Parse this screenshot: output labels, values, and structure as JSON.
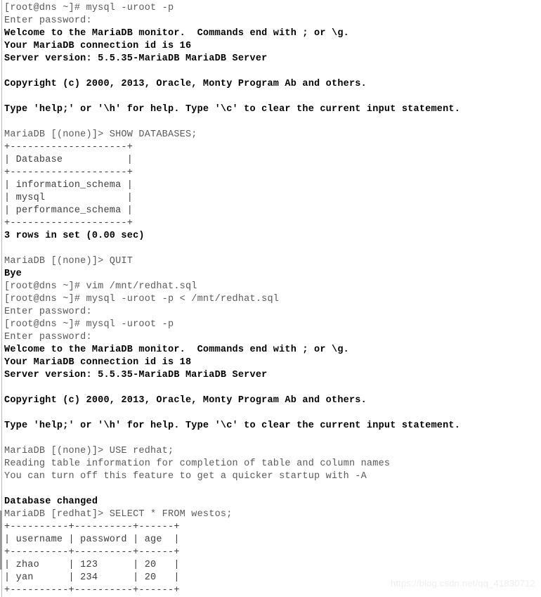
{
  "terminal": {
    "title": "MariaDB terminal session",
    "background_color": "#ffffff",
    "prompt_color": "#5a5a5a",
    "output_color": "#000000",
    "table_color": "#3d3d3d",
    "lines": [
      {
        "id": "l01",
        "style": "prompt",
        "text": "[root@dns ~]# mysql -uroot -p"
      },
      {
        "id": "l02",
        "style": "prompt",
        "text": "Enter password:"
      },
      {
        "id": "l03",
        "style": "bold",
        "text": "Welcome to the MariaDB monitor.  Commands end with ; or \\g."
      },
      {
        "id": "l04",
        "style": "bold",
        "text": "Your MariaDB connection id is 16"
      },
      {
        "id": "l05",
        "style": "bold",
        "text": "Server version: 5.5.35-MariaDB MariaDB Server"
      },
      {
        "id": "l06",
        "style": "blank",
        "text": " "
      },
      {
        "id": "l07",
        "style": "bold",
        "text": "Copyright (c) 2000, 2013, Oracle, Monty Program Ab and others."
      },
      {
        "id": "l08",
        "style": "blank",
        "text": " "
      },
      {
        "id": "l09",
        "style": "bold",
        "text": "Type 'help;' or '\\h' for help. Type '\\c' to clear the current input statement."
      },
      {
        "id": "l10",
        "style": "blank",
        "text": " "
      },
      {
        "id": "l11",
        "style": "prompt",
        "text": "MariaDB [(none)]> SHOW DATABASES;"
      },
      {
        "id": "l12",
        "style": "art",
        "text": "+--------------------+"
      },
      {
        "id": "l13",
        "style": "art",
        "text": "| Database           |"
      },
      {
        "id": "l14",
        "style": "art",
        "text": "+--------------------+"
      },
      {
        "id": "l15",
        "style": "art",
        "text": "| information_schema |"
      },
      {
        "id": "l16",
        "style": "art",
        "text": "| mysql              |"
      },
      {
        "id": "l17",
        "style": "art",
        "text": "| performance_schema |"
      },
      {
        "id": "l18",
        "style": "art",
        "text": "+--------------------+"
      },
      {
        "id": "l19",
        "style": "bold",
        "text": "3 rows in set (0.00 sec)"
      },
      {
        "id": "l20",
        "style": "blank",
        "text": " "
      },
      {
        "id": "l21",
        "style": "prompt",
        "text": "MariaDB [(none)]> QUIT"
      },
      {
        "id": "l22",
        "style": "bold",
        "text": "Bye"
      },
      {
        "id": "l23",
        "style": "prompt",
        "text": "[root@dns ~]# vim /mnt/redhat.sql"
      },
      {
        "id": "l24",
        "style": "prompt",
        "text": "[root@dns ~]# mysql -uroot -p < /mnt/redhat.sql"
      },
      {
        "id": "l25",
        "style": "prompt",
        "text": "Enter password:"
      },
      {
        "id": "l26",
        "style": "prompt",
        "text": "[root@dns ~]# mysql -uroot -p"
      },
      {
        "id": "l27",
        "style": "prompt",
        "text": "Enter password:"
      },
      {
        "id": "l28",
        "style": "bold",
        "text": "Welcome to the MariaDB monitor.  Commands end with ; or \\g."
      },
      {
        "id": "l29",
        "style": "bold",
        "text": "Your MariaDB connection id is 18"
      },
      {
        "id": "l30",
        "style": "bold",
        "text": "Server version: 5.5.35-MariaDB MariaDB Server"
      },
      {
        "id": "l31",
        "style": "blank",
        "text": " "
      },
      {
        "id": "l32",
        "style": "bold",
        "text": "Copyright (c) 2000, 2013, Oracle, Monty Program Ab and others."
      },
      {
        "id": "l33",
        "style": "blank",
        "text": " "
      },
      {
        "id": "l34",
        "style": "bold",
        "text": "Type 'help;' or '\\h' for help. Type '\\c' to clear the current input statement."
      },
      {
        "id": "l35",
        "style": "blank",
        "text": " "
      },
      {
        "id": "l36",
        "style": "prompt",
        "text": "MariaDB [(none)]> USE redhat;"
      },
      {
        "id": "l37",
        "style": "prompt",
        "text": "Reading table information for completion of table and column names"
      },
      {
        "id": "l38",
        "style": "prompt",
        "text": "You can turn off this feature to get a quicker startup with -A"
      },
      {
        "id": "l39",
        "style": "blank",
        "text": " "
      },
      {
        "id": "l40",
        "style": "bold",
        "text": "Database changed"
      },
      {
        "id": "l41",
        "style": "prompt",
        "text": "MariaDB [redhat]> SELECT * FROM westos;"
      },
      {
        "id": "l42",
        "style": "art",
        "text": "+----------+----------+------+"
      },
      {
        "id": "l43",
        "style": "art",
        "text": "| username | password | age  |"
      },
      {
        "id": "l44",
        "style": "art",
        "text": "+----------+----------+------+"
      },
      {
        "id": "l45",
        "style": "art",
        "text": "| zhao     | 123      | 20   |"
      },
      {
        "id": "l46",
        "style": "art",
        "text": "| yan      | 234      | 20   |"
      },
      {
        "id": "l47",
        "style": "art",
        "text": "+----------+----------+------+"
      }
    ]
  },
  "session": {
    "commands": [
      "mysql -uroot -p",
      "SHOW DATABASES;",
      "QUIT",
      "vim /mnt/redhat.sql",
      "mysql -uroot -p < /mnt/redhat.sql",
      "mysql -uroot -p",
      "USE redhat;",
      "SELECT * FROM westos;"
    ],
    "shell_prompt": "[root@dns ~]#",
    "mysql_prompt_none": "MariaDB [(none)]>",
    "mysql_prompt_redhat": "MariaDB [redhat]>",
    "connection_ids": [
      "16",
      "18"
    ],
    "server_version": "5.5.35-MariaDB MariaDB Server",
    "databases_result": {
      "header": "Database",
      "rows": [
        "information_schema",
        "mysql",
        "performance_schema"
      ],
      "row_count_text": "3 rows in set (0.00 sec)"
    },
    "westos_result": {
      "headers": [
        "username",
        "password",
        "age"
      ],
      "rows": [
        [
          "zhao",
          "123",
          "20"
        ],
        [
          "yan",
          "234",
          "20"
        ]
      ]
    }
  },
  "watermark": {
    "text": "https://blog.csdn.net/qq_41830712"
  }
}
